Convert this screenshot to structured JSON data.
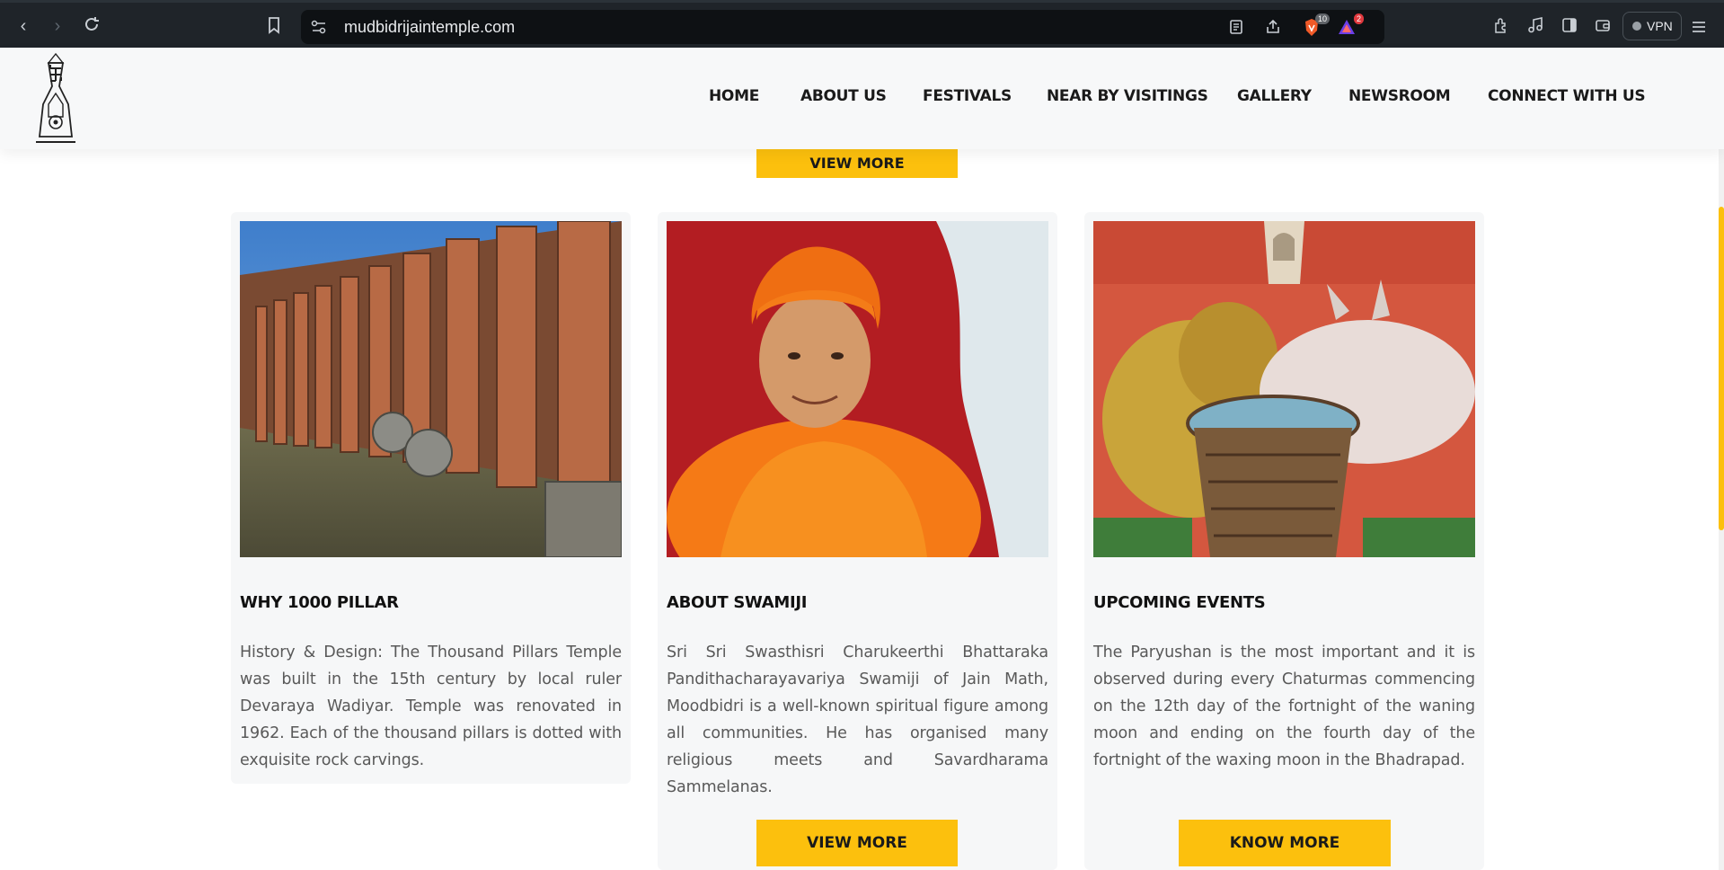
{
  "browser": {
    "url": "mudbidrijaintemple.com",
    "shields_badge": "10",
    "rewards_badge": "2",
    "vpn_label": "VPN"
  },
  "site": {
    "logo_name": "jain-emblem-logo",
    "nav": [
      {
        "label": "HOME"
      },
      {
        "label": "ABOUT US"
      },
      {
        "label": "FESTIVALS"
      },
      {
        "label": "NEAR BY VISITINGS"
      },
      {
        "label": "GALLERY"
      },
      {
        "label": "NEWSROOM"
      },
      {
        "label": "CONNECT WITH US"
      }
    ]
  },
  "top_button": {
    "label": "VIEW MORE"
  },
  "cards": [
    {
      "title": "WHY 1000 PILLAR",
      "text": "History & Design: The Thousand Pillars Temple was built in the 15th century by local ruler Devaraya Wadiyar. Temple was renovated in 1962. Each of the thousand pillars is dotted with exquisite rock carvings.",
      "image": "temple-pillars-photo"
    },
    {
      "title": "ABOUT SWAMIJI",
      "text": "Sri Sri Swasthisri Charukeerthi Bhattaraka Pandithacharayavariya Swamiji of Jain Math, Moodbidri is a well-known spiritual figure among all communities. He has organised many religious meets and Savardharama Sammelanas.",
      "image": "swamiji-portrait-photo",
      "button": "VIEW MORE"
    },
    {
      "title": "UPCOMING EVENTS",
      "text": "The Paryushan is the most important and it is observed during every Chaturmas commencing on the 12th day of the fortnight of the waning moon and ending on the fourth day of the fortnight of the waxing moon in the Bhadrapad.",
      "image": "lion-and-cow-carving-photo",
      "button": "KNOW MORE"
    }
  ],
  "colors": {
    "accent": "#fcc00d",
    "header_bg": "#f7f8f9",
    "card_bg": "#f6f7f8",
    "text": "#595959"
  }
}
